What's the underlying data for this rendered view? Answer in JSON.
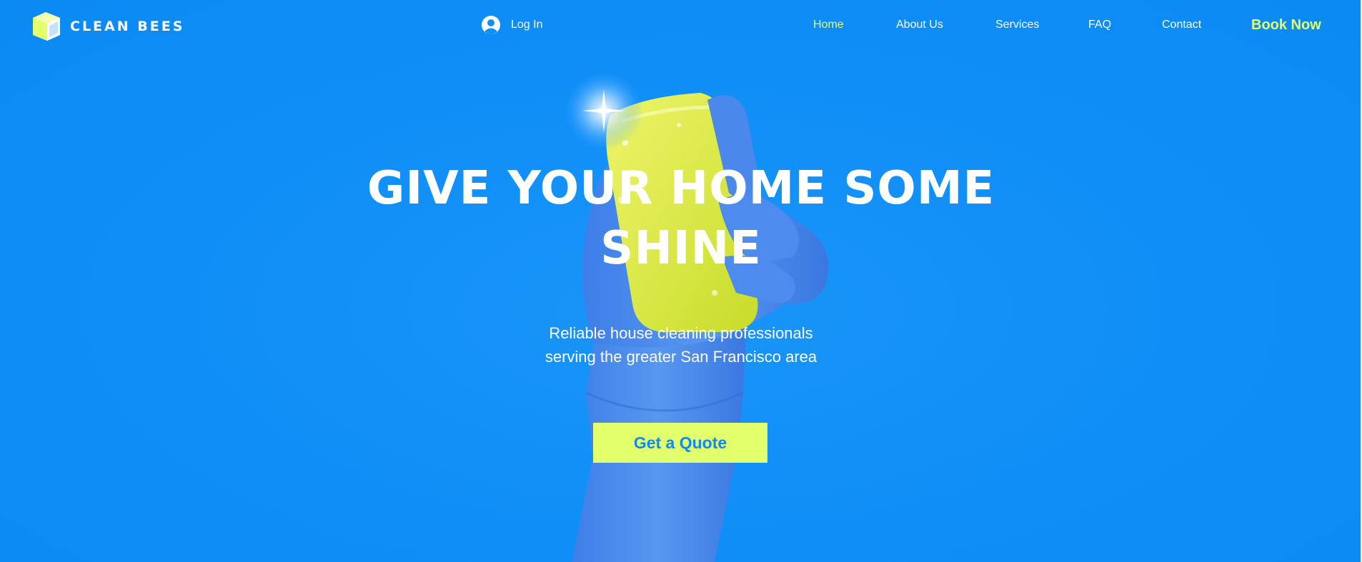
{
  "brand": {
    "name": "CLEAN BEES",
    "logo_icon": "box-logo-icon"
  },
  "header": {
    "login_label": "Log In",
    "login_icon": "user-circle-icon",
    "nav": [
      {
        "label": "Home",
        "active": true
      },
      {
        "label": "About Us",
        "active": false
      },
      {
        "label": "Services",
        "active": false
      },
      {
        "label": "FAQ",
        "active": false
      },
      {
        "label": "Contact",
        "active": false
      }
    ],
    "book_now_label": "Book Now"
  },
  "hero": {
    "title_line1": "GIVE YOUR HOME SOME",
    "title_line2": "SHINE",
    "subtitle_line1": "Reliable house cleaning professionals",
    "subtitle_line2": "serving the greater San Francisco area",
    "cta_label": "Get a Quote",
    "image": "gloved-hand-holding-sponge"
  },
  "colors": {
    "background": "#1191f8",
    "accent": "#e2ff6c",
    "text": "#ffffff",
    "cta_text": "#1189f0"
  }
}
